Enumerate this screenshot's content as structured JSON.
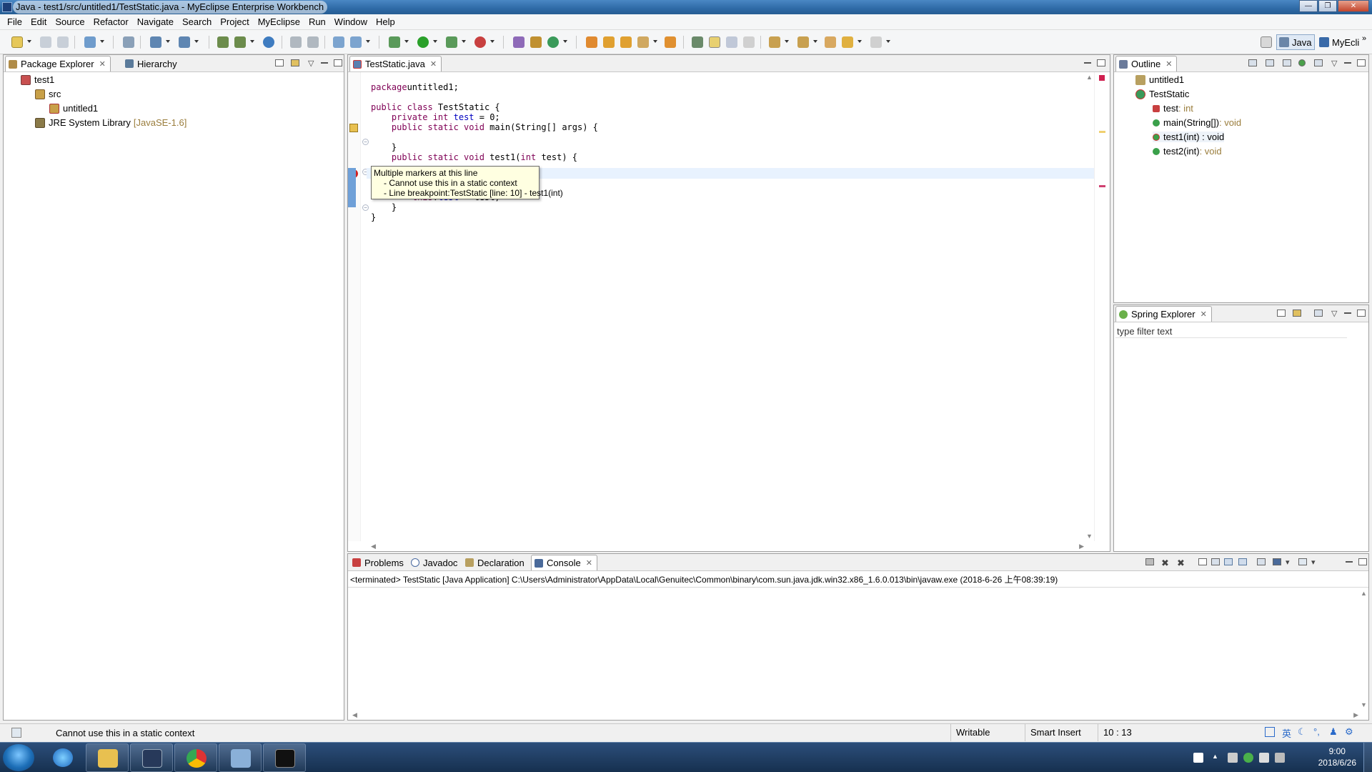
{
  "window": {
    "title": "Java - test1/src/untitled1/TestStatic.java - MyEclipse Enterprise Workbench"
  },
  "menu": [
    "File",
    "Edit",
    "Source",
    "Refactor",
    "Navigate",
    "Search",
    "Project",
    "MyEclipse",
    "Run",
    "Window",
    "Help"
  ],
  "perspectives": {
    "java": "Java",
    "myeclipse": "MyEcli"
  },
  "package_explorer": {
    "tabs": [
      "Package Explorer",
      "Hierarchy"
    ],
    "tree": [
      {
        "label": "test1",
        "icon": "project-icon"
      },
      {
        "label": "src",
        "icon": "source-folder-icon"
      },
      {
        "label": "untitled1",
        "icon": "package-icon"
      },
      {
        "label": "JRE System Library",
        "version": "[JavaSE-1.6]",
        "icon": "library-icon"
      }
    ]
  },
  "editor": {
    "tab": "TestStatic.java",
    "code": [
      {
        "parts": [
          [
            "kw",
            "package"
          ],
          [
            "",
            "untitled1;"
          ]
        ]
      },
      {
        "parts": [
          [
            "",
            ""
          ]
        ]
      },
      {
        "parts": [
          [
            "kw",
            "public class"
          ],
          [
            "",
            " TestStatic {"
          ]
        ]
      },
      {
        "parts": [
          [
            "",
            "    "
          ],
          [
            "kw",
            "private int"
          ],
          [
            "",
            " "
          ],
          [
            "fld",
            "test"
          ],
          [
            "",
            " = 0;"
          ]
        ]
      },
      {
        "parts": [
          [
            "",
            "    "
          ],
          [
            "kw",
            "public static void"
          ],
          [
            "",
            " main(String[] args) {"
          ]
        ]
      },
      {
        "parts": [
          [
            "",
            ""
          ]
        ]
      },
      {
        "parts": [
          [
            "",
            "    }"
          ]
        ]
      },
      {
        "parts": [
          [
            "",
            "    "
          ],
          [
            "kw",
            "public static void"
          ],
          [
            "",
            " test1("
          ],
          [
            "kw",
            "int"
          ],
          [
            "",
            " test) {"
          ]
        ]
      },
      {
        "parts": [
          [
            "",
            ""
          ]
        ]
      },
      {
        "parts": [
          [
            "",
            ""
          ]
        ]
      },
      {
        "parts": [
          [
            "",
            ""
          ]
        ]
      },
      {
        "parts": [
          [
            "",
            "        "
          ],
          [
            "kw",
            "this"
          ],
          [
            "",
            "."
          ],
          [
            "fld",
            "test"
          ],
          [
            "",
            " = test;"
          ]
        ]
      },
      {
        "parts": [
          [
            "",
            "    }"
          ]
        ]
      },
      {
        "parts": [
          [
            "",
            "}"
          ]
        ]
      }
    ],
    "hover": {
      "title": "Multiple markers at this line",
      "lines": [
        "- Cannot use this in a static context",
        "- Line breakpoint:TestStatic [line: 10] - test1(int)"
      ]
    }
  },
  "outline": {
    "tab": "Outline",
    "items": [
      {
        "name": "untitled1",
        "type": "",
        "icon": "package-icon"
      },
      {
        "name": "TestStatic",
        "type": "",
        "icon": "class-icon"
      },
      {
        "name": "test",
        "type": " : int",
        "icon": "private-field-icon"
      },
      {
        "name": "main(String[])",
        "type": " : void",
        "icon": "public-static-method-icon"
      },
      {
        "name": "test1(int) : void",
        "type": "",
        "icon": "public-static-method-error-icon"
      },
      {
        "name": "test2(int)",
        "type": " : void",
        "icon": "public-method-icon"
      }
    ]
  },
  "spring_explorer": {
    "tab": "Spring Explorer",
    "filter_placeholder": "type filter text"
  },
  "bottom_panel": {
    "tabs": [
      "Problems",
      "Javadoc",
      "Declaration",
      "Console"
    ],
    "console_header": "<terminated> TestStatic [Java Application] C:\\Users\\Administrator\\AppData\\Local\\Genuitec\\Common\\binary\\com.sun.java.jdk.win32.x86_1.6.0.013\\bin\\javaw.exe (2018-6-26 上午08:39:19)"
  },
  "status_bar": {
    "message": "Cannot use this in a static context",
    "writable": "Writable",
    "insert_mode": "Smart Insert",
    "position": "10 : 13",
    "ime_label": "英"
  },
  "taskbar": {
    "time": "9:00",
    "date": "2018/6/26",
    "apps": [
      "ie-icon",
      "explorer-icon",
      "myeclipse-icon",
      "chrome-icon",
      "remote-desktop-icon",
      "cmd-icon"
    ]
  },
  "colors": {
    "keyword": "#7f0055",
    "field": "#0000c0",
    "hover_bg": "#ffffe1",
    "current_line": "#e8f2fe",
    "error": "#d22020"
  }
}
